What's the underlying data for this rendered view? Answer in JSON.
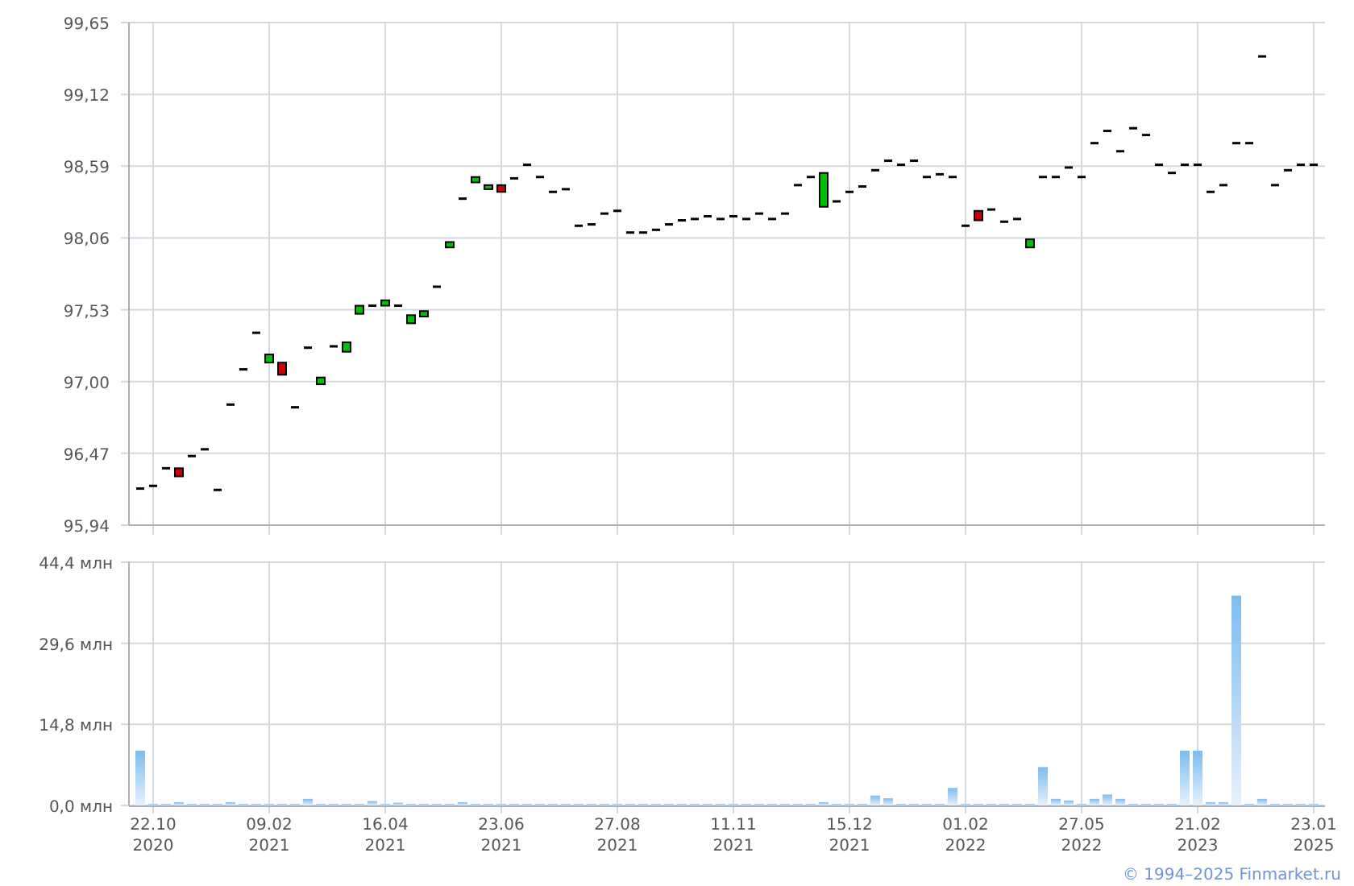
{
  "price_chart": {
    "chart_data": {
      "type": "candlestick",
      "grid": true,
      "ylim": [
        95.94,
        99.65
      ],
      "yticks": [
        {
          "value": 95.94,
          "label": "95,94"
        },
        {
          "value": 96.47,
          "label": "96,47"
        },
        {
          "value": 97.0,
          "label": "97,00"
        },
        {
          "value": 97.53,
          "label": "97,53"
        },
        {
          "value": 98.06,
          "label": "98,06"
        },
        {
          "value": 98.59,
          "label": "98,59"
        },
        {
          "value": 99.12,
          "label": "99,12"
        },
        {
          "value": 99.65,
          "label": "99,65"
        }
      ],
      "categories": [
        null,
        null,
        null,
        null,
        null,
        null,
        null,
        null,
        null,
        null,
        null,
        null,
        null,
        null,
        null,
        null,
        null,
        null,
        null,
        null,
        null,
        null,
        null,
        null,
        null,
        null,
        null,
        null,
        null,
        null,
        null,
        null,
        null,
        null,
        null,
        null,
        null,
        null,
        null,
        null,
        null,
        null,
        null,
        null,
        null,
        null,
        null,
        null,
        null,
        null,
        null,
        null,
        null,
        null,
        null,
        null,
        null,
        null,
        null,
        null,
        null,
        null,
        null,
        null,
        null,
        null,
        null,
        null,
        null,
        null,
        null,
        null,
        null,
        null,
        null,
        null,
        null,
        null,
        null,
        null,
        null,
        null,
        null,
        null,
        null,
        null,
        null,
        null,
        null,
        null,
        null,
        null
      ],
      "ohlc": [
        [
          96.21,
          96.21,
          96.21,
          96.21
        ],
        [
          96.23,
          96.23,
          96.23,
          96.23
        ],
        [
          96.36,
          96.36,
          96.36,
          96.36
        ],
        [
          96.36,
          96.36,
          96.3,
          96.3
        ],
        [
          96.45,
          96.45,
          96.45,
          96.45
        ],
        [
          96.5,
          96.5,
          96.5,
          96.5
        ],
        [
          96.2,
          96.2,
          96.2,
          96.2
        ],
        [
          96.83,
          96.83,
          96.83,
          96.83
        ],
        [
          97.09,
          97.09,
          97.09,
          97.09
        ],
        [
          97.36,
          97.36,
          97.36,
          97.36
        ],
        [
          97.14,
          97.2,
          97.14,
          97.2
        ],
        [
          97.14,
          97.14,
          97.05,
          97.05
        ],
        [
          96.81,
          96.81,
          96.81,
          96.81
        ],
        [
          97.25,
          97.25,
          97.25,
          97.25
        ],
        [
          96.98,
          97.03,
          96.98,
          97.03
        ],
        [
          97.26,
          97.26,
          97.26,
          97.26
        ],
        [
          97.22,
          97.29,
          97.22,
          97.29
        ],
        [
          97.5,
          97.56,
          97.5,
          97.56
        ],
        [
          97.56,
          97.56,
          97.56,
          97.56
        ],
        [
          97.56,
          97.6,
          97.56,
          97.6
        ],
        [
          97.56,
          97.56,
          97.56,
          97.56
        ],
        [
          97.43,
          97.49,
          97.43,
          97.49
        ],
        [
          97.48,
          97.52,
          97.48,
          97.52
        ],
        [
          97.7,
          97.7,
          97.7,
          97.7
        ],
        [
          97.99,
          98.03,
          97.99,
          98.03
        ],
        [
          98.35,
          98.35,
          98.35,
          98.35
        ],
        [
          98.47,
          98.51,
          98.47,
          98.51
        ],
        [
          98.42,
          98.45,
          98.42,
          98.45
        ],
        [
          98.45,
          98.45,
          98.4,
          98.4
        ],
        [
          98.5,
          98.5,
          98.5,
          98.5
        ],
        [
          98.6,
          98.6,
          98.6,
          98.6
        ],
        [
          98.51,
          98.51,
          98.51,
          98.51
        ],
        [
          98.4,
          98.4,
          98.4,
          98.4
        ],
        [
          98.42,
          98.42,
          98.42,
          98.42
        ],
        [
          98.15,
          98.15,
          98.15,
          98.15
        ],
        [
          98.16,
          98.16,
          98.16,
          98.16
        ],
        [
          98.24,
          98.24,
          98.24,
          98.24
        ],
        [
          98.26,
          98.26,
          98.26,
          98.26
        ],
        [
          98.1,
          98.1,
          98.1,
          98.1
        ],
        [
          98.1,
          98.1,
          98.1,
          98.1
        ],
        [
          98.12,
          98.12,
          98.12,
          98.12
        ],
        [
          98.16,
          98.16,
          98.16,
          98.16
        ],
        [
          98.19,
          98.19,
          98.19,
          98.19
        ],
        [
          98.2,
          98.2,
          98.2,
          98.2
        ],
        [
          98.22,
          98.22,
          98.22,
          98.22
        ],
        [
          98.2,
          98.2,
          98.2,
          98.2
        ],
        [
          98.22,
          98.22,
          98.22,
          98.22
        ],
        [
          98.2,
          98.2,
          98.2,
          98.2
        ],
        [
          98.24,
          98.24,
          98.24,
          98.24
        ],
        [
          98.2,
          98.2,
          98.2,
          98.2
        ],
        [
          98.24,
          98.24,
          98.24,
          98.24
        ],
        [
          98.45,
          98.45,
          98.45,
          98.45
        ],
        [
          98.51,
          98.51,
          98.51,
          98.51
        ],
        [
          98.29,
          98.54,
          98.29,
          98.54
        ],
        [
          98.33,
          98.33,
          98.33,
          98.33
        ],
        [
          98.4,
          98.4,
          98.4,
          98.4
        ],
        [
          98.44,
          98.44,
          98.44,
          98.44
        ],
        [
          98.56,
          98.56,
          98.56,
          98.56
        ],
        [
          98.63,
          98.63,
          98.63,
          98.63
        ],
        [
          98.6,
          98.6,
          98.6,
          98.6
        ],
        [
          98.63,
          98.63,
          98.63,
          98.63
        ],
        [
          98.51,
          98.51,
          98.51,
          98.51
        ],
        [
          98.53,
          98.53,
          98.53,
          98.53
        ],
        [
          98.51,
          98.51,
          98.51,
          98.51
        ],
        [
          98.15,
          98.15,
          98.15,
          98.15
        ],
        [
          98.26,
          98.26,
          98.19,
          98.19
        ],
        [
          98.27,
          98.27,
          98.27,
          98.27
        ],
        [
          98.18,
          98.18,
          98.18,
          98.18
        ],
        [
          98.2,
          98.2,
          98.2,
          98.2
        ],
        [
          97.99,
          98.05,
          97.99,
          98.05
        ],
        [
          98.51,
          98.51,
          98.51,
          98.51
        ],
        [
          98.51,
          98.51,
          98.51,
          98.51
        ],
        [
          98.58,
          98.58,
          98.58,
          98.58
        ],
        [
          98.51,
          98.51,
          98.51,
          98.51
        ],
        [
          98.76,
          98.76,
          98.76,
          98.76
        ],
        [
          98.85,
          98.85,
          98.85,
          98.85
        ],
        [
          98.7,
          98.7,
          98.7,
          98.7
        ],
        [
          98.87,
          98.87,
          98.87,
          98.87
        ],
        [
          98.82,
          98.82,
          98.82,
          98.82
        ],
        [
          98.6,
          98.6,
          98.6,
          98.6
        ],
        [
          98.54,
          98.54,
          98.54,
          98.54
        ],
        [
          98.6,
          98.6,
          98.6,
          98.6
        ],
        [
          98.6,
          98.6,
          98.6,
          98.6
        ],
        [
          98.4,
          98.4,
          98.4,
          98.4
        ],
        [
          98.45,
          98.45,
          98.45,
          98.45
        ],
        [
          98.76,
          98.76,
          98.76,
          98.76
        ],
        [
          98.76,
          98.76,
          98.76,
          98.76
        ],
        [
          99.4,
          99.4,
          99.4,
          99.4
        ],
        [
          98.45,
          98.45,
          98.45,
          98.45
        ],
        [
          98.56,
          98.56,
          98.56,
          98.56
        ],
        [
          98.6,
          98.6,
          98.6,
          98.6
        ],
        [
          98.6,
          98.6,
          98.6,
          98.6
        ]
      ]
    }
  },
  "volume_chart": {
    "chart_data": {
      "type": "bar",
      "grid": true,
      "ylim": [
        0,
        44.4
      ],
      "yticks": [
        {
          "value": 0,
          "label": "0,0 млн"
        },
        {
          "value": 14.8,
          "label": "14,8 млн"
        },
        {
          "value": 29.6,
          "label": "29,6 млн"
        },
        {
          "value": 44.4,
          "label": "44,4 млн"
        }
      ],
      "categories": [
        null,
        "22.10\n2020",
        null,
        null,
        null,
        null,
        null,
        null,
        null,
        null,
        "09.02\n2021",
        null,
        null,
        null,
        null,
        null,
        null,
        null,
        null,
        "16.04\n2021",
        null,
        null,
        null,
        null,
        null,
        null,
        null,
        null,
        "23.06\n2021",
        null,
        null,
        null,
        null,
        null,
        null,
        null,
        null,
        "27.08\n2021",
        null,
        null,
        null,
        null,
        null,
        null,
        null,
        null,
        "11.11\n2021",
        null,
        null,
        null,
        null,
        null,
        null,
        null,
        null,
        "15.12\n2021",
        null,
        null,
        null,
        null,
        null,
        null,
        null,
        null,
        "01.02\n2022",
        null,
        null,
        null,
        null,
        null,
        null,
        null,
        null,
        "27.05\n2022",
        null,
        null,
        null,
        null,
        null,
        null,
        null,
        null,
        "21.02\n2023",
        null,
        null,
        null,
        null,
        null,
        null,
        null,
        null,
        "23.01\n2025"
      ],
      "series": [
        {
          "color": "#7dbcf0",
          "values": [
            10.0,
            0.3,
            0.3,
            0.6,
            0.3,
            0.3,
            0.3,
            0.6,
            0.3,
            0.3,
            0.3,
            0.3,
            0.3,
            1.2,
            0.3,
            0.3,
            0.3,
            0.3,
            0.8,
            0.3,
            0.5,
            0.3,
            0.3,
            0.3,
            0.3,
            0.6,
            0.3,
            0.3,
            0.3,
            0.3,
            0.3,
            0.3,
            0.3,
            0.3,
            0.3,
            0.3,
            0.3,
            0.3,
            0.3,
            0.3,
            0.3,
            0.3,
            0.3,
            0.3,
            0.3,
            0.3,
            0.3,
            0.3,
            0.3,
            0.3,
            0.3,
            0.3,
            0.3,
            0.6,
            0.3,
            0.3,
            0.3,
            1.8,
            1.3,
            0.3,
            0.3,
            0.3,
            0.3,
            3.2,
            0.3,
            0.3,
            0.3,
            0.3,
            0.3,
            0.3,
            7.0,
            1.2,
            0.9,
            0.3,
            1.2,
            2.0,
            1.2,
            0.3,
            0.3,
            0.3,
            0.3,
            10.0,
            10.0,
            0.6,
            0.6,
            38.3,
            0.3,
            1.2,
            0.3,
            0.3,
            0.3,
            0.3
          ]
        }
      ]
    }
  },
  "copyright": "© 1994–2025 Finmarket.ru"
}
